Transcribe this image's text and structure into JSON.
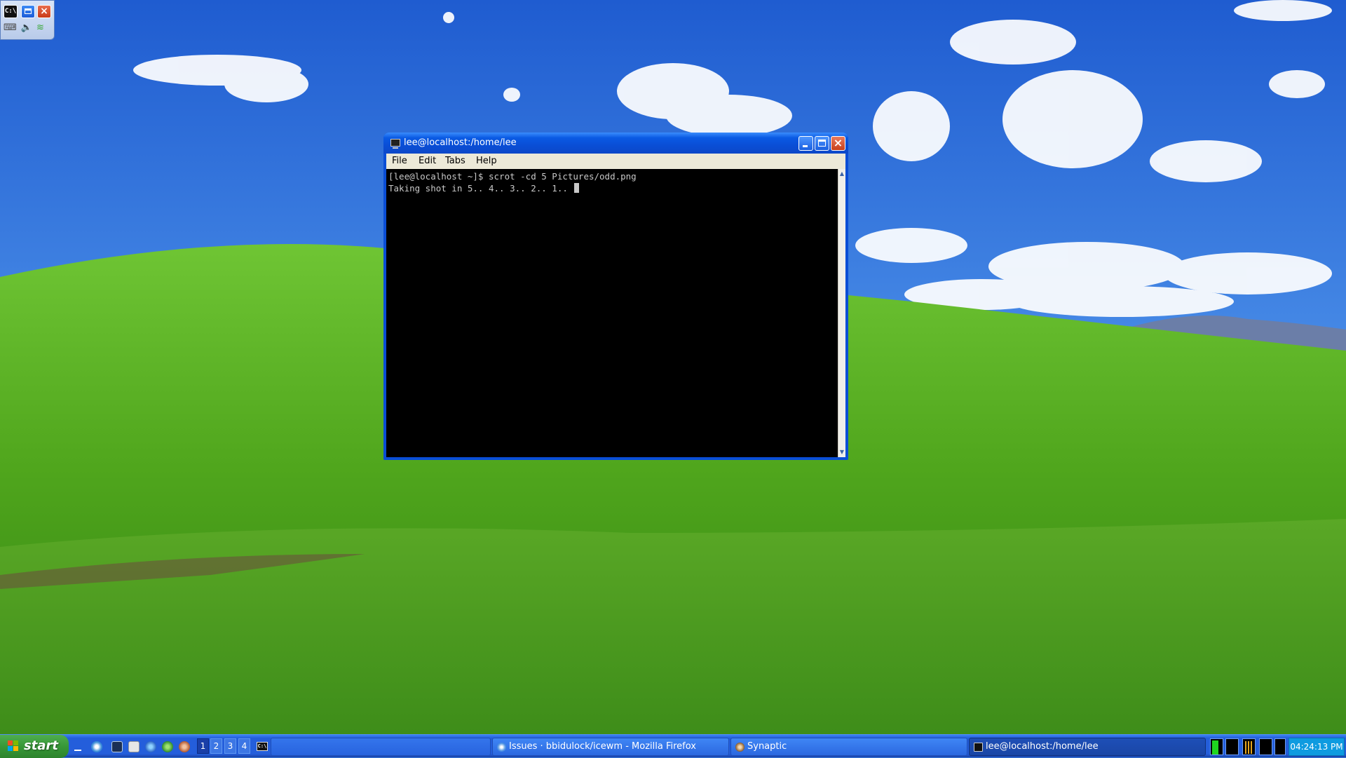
{
  "mini_tray": {
    "terminal_glyph": "C:\\"
  },
  "window": {
    "title": "lee@localhost:/home/lee",
    "menus": [
      "File",
      "Edit",
      "Tabs",
      "Help"
    ],
    "terminal_lines": [
      "[lee@localhost ~]$ scrot -cd 5 Pictures/odd.png",
      "Taking shot in 5.. 4.. 3.. 2.. 1.. "
    ]
  },
  "taskbar": {
    "start_label": "start",
    "workspaces": [
      "1",
      "2",
      "3",
      "4"
    ],
    "active_workspace": "1",
    "tasks": [
      {
        "label": "Issues · bbidulock/icewm - Mozilla Firefox",
        "icon": "firefox-icon"
      },
      {
        "label": "Synaptic",
        "icon": "synaptic-icon"
      },
      {
        "label": "lee@localhost:/home/lee",
        "icon": "terminal-icon",
        "active": true
      }
    ],
    "clock": "04:24:13 PM"
  },
  "colors": {
    "titlebar": "#0a4ed6",
    "taskbar": "#245edb",
    "start_button": "#379837",
    "clock_bg": "#0e9be0"
  }
}
